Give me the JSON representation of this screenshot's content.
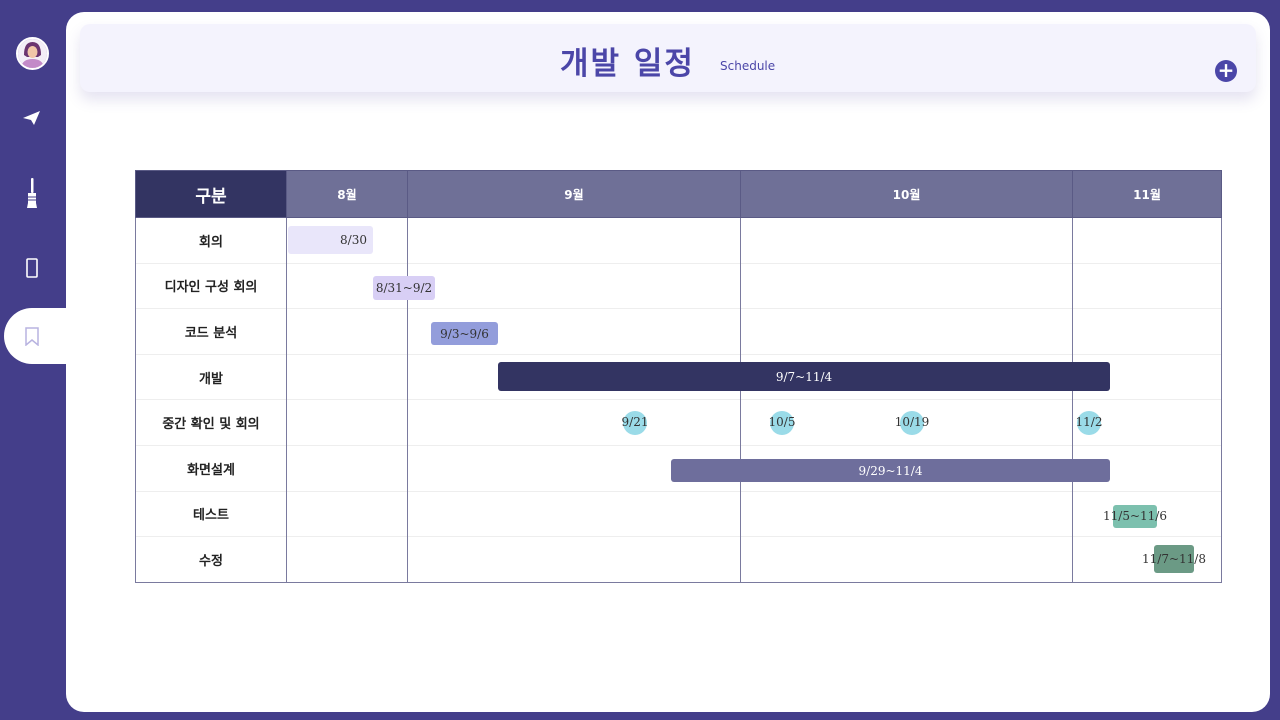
{
  "header": {
    "title": "개발 일정",
    "subtitle": "Schedule",
    "add_label": "+"
  },
  "sidebar": {
    "items": [
      {
        "icon": "avatar"
      },
      {
        "icon": "paper-plane-icon"
      },
      {
        "icon": "brush-icon"
      },
      {
        "icon": "mobile-icon"
      },
      {
        "icon": "bookmark-icon",
        "active": true
      }
    ]
  },
  "table": {
    "corner": "구분",
    "months": [
      "8월",
      "9월",
      "10월",
      "11월"
    ],
    "rows": [
      "회의",
      "디자인 구성 회의",
      "코드 분석",
      "개발",
      "중간 확인 및 회의",
      "화면설계",
      "테스트",
      "수정"
    ]
  },
  "bars": {
    "meeting": "8/30",
    "design": "8/31~9/2",
    "code": "9/3~9/6",
    "dev": "9/7~11/4",
    "mid": [
      "9/21",
      "10/5",
      "10/19",
      "11/2"
    ],
    "screen": "9/29~11/4",
    "test": "11/5~11/6",
    "fix": "11/7~11/8"
  },
  "colors": {
    "sidebar": "#443e8a",
    "accent": "#4b46a8",
    "dev": "#333462",
    "screen": "#6e6e9c",
    "milestone": "#9adbe8",
    "test": "#7cc0ae",
    "fix": "#6b9a85"
  }
}
